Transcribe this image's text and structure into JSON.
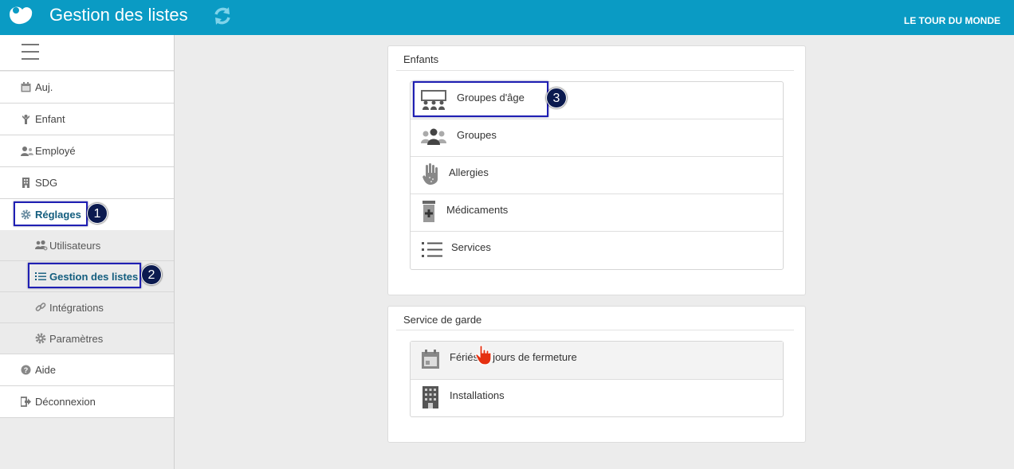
{
  "header": {
    "title": "Gestion des listes",
    "org_name": "LE TOUR DU MONDE"
  },
  "colors": {
    "header_bg": "#0a9bc4",
    "active_text": "#135d7e",
    "highlight_border": "#1f1fb3",
    "badge_bg": "#0b1a4f"
  },
  "sidebar": {
    "items": [
      {
        "label": "Auj.",
        "icon": "calendar-icon"
      },
      {
        "label": "Enfant",
        "icon": "child-icon"
      },
      {
        "label": "Employé",
        "icon": "employee-icon"
      },
      {
        "label": "SDG",
        "icon": "building-icon"
      },
      {
        "label": "Réglages",
        "icon": "gear-icon",
        "active": true
      },
      {
        "label": "Aide",
        "icon": "help-icon"
      },
      {
        "label": "Déconnexion",
        "icon": "logout-icon"
      }
    ],
    "subitems": [
      {
        "label": "Utilisateurs",
        "icon": "users-icon"
      },
      {
        "label": "Gestion des listes",
        "icon": "list-icon",
        "active": true
      },
      {
        "label": "Intégrations",
        "icon": "link-icon"
      },
      {
        "label": "Paramètres",
        "icon": "gear-icon"
      }
    ]
  },
  "annotations": [
    "1",
    "2",
    "3"
  ],
  "panels": {
    "enfants": {
      "title": "Enfants",
      "items": [
        {
          "label": "Groupes d'âge",
          "icon": "age-groups-icon"
        },
        {
          "label": "Groupes",
          "icon": "groups-icon"
        },
        {
          "label": "Allergies",
          "icon": "allergy-hand-icon"
        },
        {
          "label": "Médicaments",
          "icon": "medication-icon"
        },
        {
          "label": "Services",
          "icon": "list-icon"
        }
      ]
    },
    "garde": {
      "title": "Service de garde",
      "items": [
        {
          "label": "Fériés et jours de fermeture",
          "icon": "calendar-icon"
        },
        {
          "label": "Installations",
          "icon": "building-icon"
        }
      ]
    }
  }
}
